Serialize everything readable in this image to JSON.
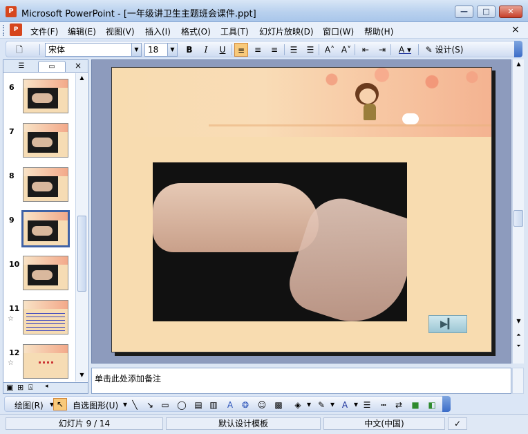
{
  "window": {
    "title": "Microsoft PowerPoint - [一年级讲卫生主题班会课件.ppt]",
    "min_label": "—",
    "max_label": "□",
    "close_label": "✕"
  },
  "menu": {
    "items": [
      "文件(F)",
      "编辑(E)",
      "视图(V)",
      "插入(I)",
      "格式(O)",
      "工具(T)",
      "幻灯片放映(D)",
      "窗口(W)",
      "帮助(H)"
    ],
    "close_label": "×"
  },
  "toolbar": {
    "font_name": "宋体",
    "font_size": "18",
    "bold": "B",
    "italic": "I",
    "underline": "U",
    "design_label": "设计(S)"
  },
  "slides_pane": {
    "close_label": "×",
    "thumbs": [
      {
        "num": "6",
        "star": ""
      },
      {
        "num": "7",
        "star": ""
      },
      {
        "num": "8",
        "star": ""
      },
      {
        "num": "9",
        "star": ""
      },
      {
        "num": "10",
        "star": ""
      },
      {
        "num": "11",
        "star": "☆"
      },
      {
        "num": "12",
        "star": "☆"
      }
    ],
    "selected": "9"
  },
  "notes": {
    "placeholder": "单击此处添加备注"
  },
  "drawing_toolbar": {
    "draw_label": "绘图(R)",
    "autoshapes_label": "自选图形(U)"
  },
  "status": {
    "slide": "幻灯片 9 / 14",
    "template": "默认设计模板",
    "language": "中文(中国)"
  },
  "colors": {
    "selection_border": "#3f62a6",
    "active_tool": "#f8c97a"
  }
}
